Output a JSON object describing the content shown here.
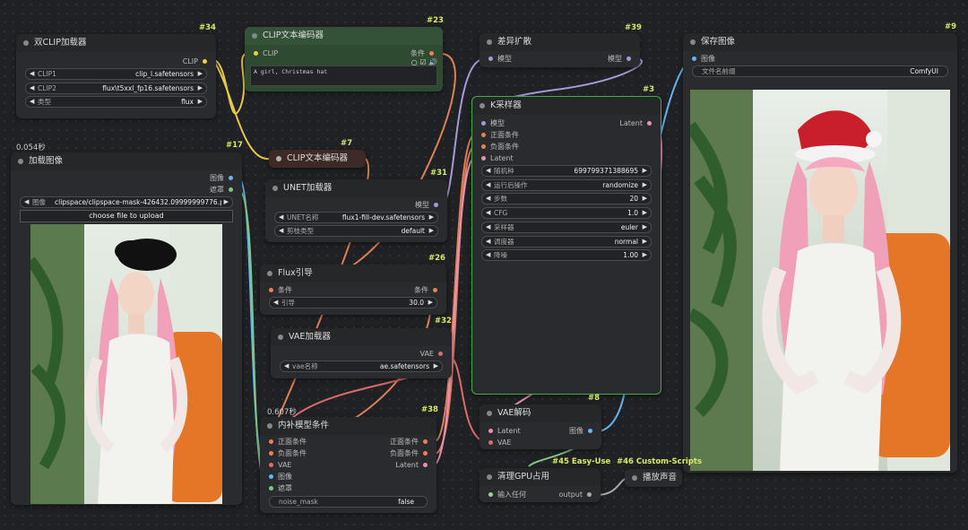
{
  "nodes": {
    "dual_clip": {
      "id": "#34",
      "title": "双CLIP加载器",
      "out_clip": "CLIP",
      "w1": {
        "label": "CLIP1",
        "value": "clip_l.safetensors"
      },
      "w2": {
        "label": "CLIP2",
        "value": "flux\\t5xxl_fp16.safetensors"
      },
      "w3": {
        "label": "类型",
        "value": "flux"
      }
    },
    "clip_text_23": {
      "id": "#23",
      "title": "CLIP文本编码器",
      "in_clip": "CLIP",
      "out_cond": "条件",
      "prompt": "A girl, Christmas hat"
    },
    "diff_expand": {
      "id": "#39",
      "title": "差异扩散",
      "in_model": "模型",
      "out_model": "模型"
    },
    "save_image": {
      "id": "#9",
      "title": "保存图像",
      "in_image": "图像",
      "w_prefix": {
        "label": "文件名前缀",
        "value": "ComfyUI"
      }
    },
    "load_image": {
      "id": "#17",
      "timing": "0.054秒",
      "title": "加载图像",
      "out_image": "图像",
      "out_mask": "遮罩",
      "w_image": {
        "label": "图像",
        "value": "clipspace/clipspace-mask-426432.09999999776.pn..."
      },
      "upload": "choose file to upload"
    },
    "clip_text_7": {
      "id": "#7",
      "title": "CLIP文本编码器"
    },
    "unet": {
      "id": "#31",
      "title": "UNET加载器",
      "out_model": "模型",
      "w1": {
        "label": "UNET名称",
        "value": "flux1-fill-dev.safetensors"
      },
      "w2": {
        "label": "剪枝类型",
        "value": "default"
      }
    },
    "flux_guide": {
      "id": "#26",
      "title": "Flux引导",
      "in_cond": "条件",
      "out_cond": "条件",
      "w1": {
        "label": "引导",
        "value": "30.0"
      }
    },
    "vae_loader": {
      "id": "#32",
      "title": "VAE加载器",
      "out_vae": "VAE",
      "w1": {
        "label": "vae名称",
        "value": "ae.safetensors"
      }
    },
    "inpaint": {
      "id": "#38",
      "timing": "0.607秒",
      "title": "内补模型条件",
      "in1": "正面条件",
      "in2": "负面条件",
      "in3": "VAE",
      "in4": "图像",
      "in5": "遮罩",
      "out1": "正面条件",
      "out2": "负面条件",
      "out3": "Latent",
      "w1": {
        "label": "noise_mask",
        "value": "false"
      }
    },
    "ksampler": {
      "id": "#3",
      "title": "K采样器",
      "in1": "模型",
      "in2": "正面条件",
      "in3": "负面条件",
      "in4": "Latent",
      "out1": "Latent",
      "widgets": [
        {
          "label": "随机种",
          "value": "699799371388695"
        },
        {
          "label": "运行后操作",
          "value": "randomize"
        },
        {
          "label": "步数",
          "value": "20"
        },
        {
          "label": "CFG",
          "value": "1.0"
        },
        {
          "label": "采样器",
          "value": "euler"
        },
        {
          "label": "调度器",
          "value": "normal"
        },
        {
          "label": "降噪",
          "value": "1.00"
        }
      ]
    },
    "vae_decode": {
      "id": "#8",
      "title": "VAE解码",
      "in1": "Latent",
      "in2": "VAE",
      "out1": "图像"
    },
    "free_gpu": {
      "id": "#45 Easy-Use",
      "title": "清理GPU占用",
      "in1": "输入任何",
      "out1": "output"
    },
    "play_sound": {
      "id": "#46 Custom-Scripts",
      "title": "播放声音"
    }
  },
  "colors": {
    "clip": "#f0d040",
    "cond": "#f08050",
    "model": "#a89ad8",
    "vae": "#e06a6a",
    "latent": "#e890b8",
    "image": "#64b5f6",
    "mask": "#81c784",
    "any": "#9bd48a",
    "accent_selected": "#3fae4a"
  }
}
